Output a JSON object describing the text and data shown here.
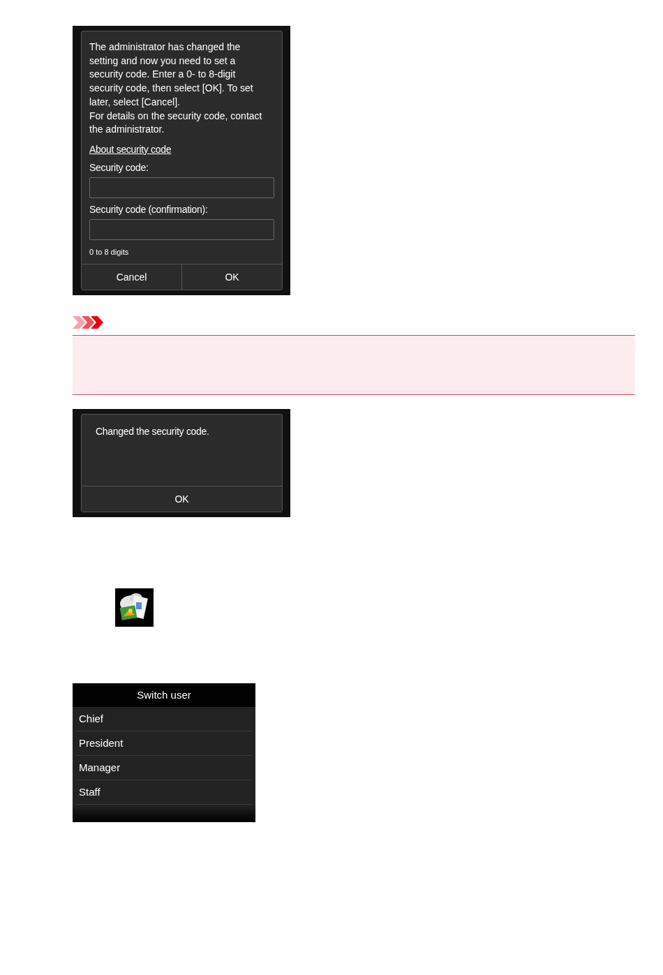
{
  "security_dialog": {
    "message": [
      "The administrator has changed the setting and now you need to set a security code. Enter a 0- to 8-digit security code, then select [OK]. To set later, select [Cancel].",
      "For details on the security code, contact the administrator."
    ],
    "link": "About security code",
    "fields": [
      {
        "label": "Security code:"
      },
      {
        "label": "Security code (confirmation):"
      }
    ],
    "hint": "0 to 8 digits",
    "buttons": [
      "Cancel",
      "OK"
    ]
  },
  "important_note": {
    "kind": "important"
  },
  "changed_dialog": {
    "message": "Changed the security code.",
    "buttons": [
      "OK"
    ]
  },
  "switch_user": {
    "title": "Switch user",
    "items": [
      "Chief",
      "President",
      "Manager",
      "Staff"
    ]
  }
}
